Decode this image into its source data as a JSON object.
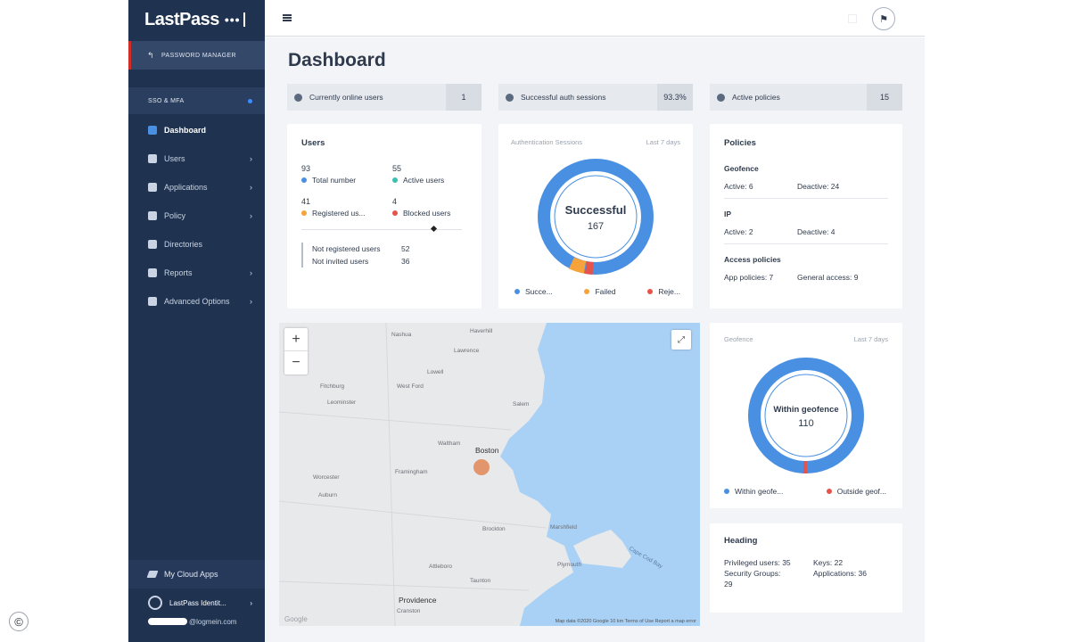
{
  "sidebar": {
    "logo": "LastPass",
    "logo_dots": "•••",
    "password_manager": "PASSWORD MANAGER",
    "section": "SSO & MFA",
    "items": [
      {
        "label": "Dashboard",
        "icon": "dashboard-icon",
        "active": true
      },
      {
        "label": "Users",
        "icon": "user-icon",
        "chevron": true
      },
      {
        "label": "Applications",
        "icon": "grid-icon",
        "chevron": true
      },
      {
        "label": "Policy",
        "icon": "hammer-icon",
        "chevron": true
      },
      {
        "label": "Directories",
        "icon": "list-icon"
      },
      {
        "label": "Reports",
        "icon": "chart-icon",
        "chevron": true
      },
      {
        "label": "Advanced Options",
        "icon": "gear-icon",
        "chevron": true
      }
    ],
    "my_cloud_apps": "My Cloud Apps",
    "user_name": "LastPass Identit...",
    "user_email": "@logmein.com"
  },
  "main": {
    "title": "Dashboard",
    "stats": [
      {
        "label": "Currently online users",
        "value": "1",
        "icon": "users-icon"
      },
      {
        "label": "Successful auth sessions",
        "value": "93.3%",
        "icon": "shield-icon"
      },
      {
        "label": "Active policies",
        "value": "15",
        "icon": "policy-icon"
      }
    ],
    "users_card": {
      "title": "Users",
      "cells": [
        {
          "number": "93",
          "label": "Total number",
          "color": "#4a90e2"
        },
        {
          "number": "55",
          "label": "Active users",
          "color": "#3bbfb1"
        },
        {
          "number": "41",
          "label": "Registered us...",
          "color": "#f5a33a"
        },
        {
          "number": "4",
          "label": "Blocked users",
          "color": "#e5534b"
        }
      ],
      "not_registered_label": "Not registered users",
      "not_registered_value": "52",
      "not_invited_label": "Not invited users",
      "not_invited_value": "36"
    },
    "auth_card": {
      "title": "Authentication Sessions",
      "range": "Last 7 days",
      "center_label": "Successful",
      "center_value": "167",
      "legend": [
        {
          "label": "Succe...",
          "color": "#4a90e2"
        },
        {
          "label": "Failed",
          "color": "#f5a33a"
        },
        {
          "label": "Reje...",
          "color": "#e5534b"
        }
      ]
    },
    "policies_card": {
      "title": "Policies",
      "geofence_title": "Geofence",
      "geofence_active": "Active: 6",
      "geofence_deactive": "Deactive: 24",
      "ip_title": "IP",
      "ip_active": "Active: 2",
      "ip_deactive": "Deactive: 4",
      "access_title": "Access policies",
      "app_policies": "App policies: 7",
      "general_access": "General access: 9"
    },
    "geofence_card": {
      "title": "Geofence",
      "range": "Last 7 days",
      "center_label": "Within geofence",
      "center_value": "110",
      "legend": [
        {
          "label": "Within geofe...",
          "color": "#4a90e2"
        },
        {
          "label": "Outside geof...",
          "color": "#e5534b"
        }
      ]
    },
    "heading_card": {
      "title": "Heading",
      "privileged": "Privileged users: 35",
      "keys": "Keys: 22",
      "security_groups": "Security Groups:",
      "security_groups_value": "29",
      "applications": "Applications: 36"
    },
    "map": {
      "zoom_in": "+",
      "zoom_out": "−",
      "fullscreen": "⤢",
      "places": [
        {
          "name": "Nashua"
        },
        {
          "name": "Haverhill"
        },
        {
          "name": "Lawrence"
        },
        {
          "name": "Lowell"
        },
        {
          "name": "Fitchburg"
        },
        {
          "name": "West Ford"
        },
        {
          "name": "Leominster"
        },
        {
          "name": "Salem"
        },
        {
          "name": "Waltham"
        },
        {
          "name": "Boston"
        },
        {
          "name": "Worcester"
        },
        {
          "name": "Framingham"
        },
        {
          "name": "Auburn"
        },
        {
          "name": "Brockton"
        },
        {
          "name": "Marshfield"
        },
        {
          "name": "Attleboro"
        },
        {
          "name": "Plymouth"
        },
        {
          "name": "Taunton"
        },
        {
          "name": "Providence"
        },
        {
          "name": "Cranston"
        },
        {
          "name": "Cape Cod Bay"
        }
      ],
      "google": "Google",
      "attribution": "Map data ©2020 Google    10 km    Terms of Use    Report a map error"
    }
  }
}
